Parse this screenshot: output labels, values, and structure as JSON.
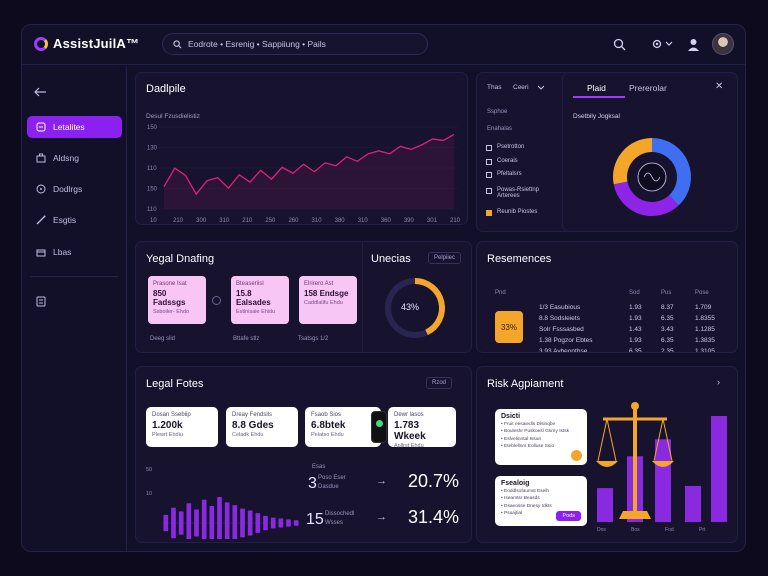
{
  "app": {
    "name": "AssistJuilA™"
  },
  "search": {
    "placeholder": "Eodrote • Esrenig • Sappiiung • Pails"
  },
  "sidebar": {
    "items": [
      {
        "label": "Letalites",
        "icon": "scale-icon"
      },
      {
        "label": "Aldsng",
        "icon": "briefcase-icon"
      },
      {
        "label": "Dodlrgs",
        "icon": "chat-icon"
      },
      {
        "label": "Esgtis",
        "icon": "pen-icon"
      },
      {
        "label": "Lbas",
        "icon": "building-icon"
      }
    ]
  },
  "timeline": {
    "title": "Dadlpile",
    "subtitle": "Desul Fzusdielistiz",
    "chart_data": {
      "type": "line",
      "y_ticks": [
        "150",
        "130",
        "110",
        "150",
        "110"
      ],
      "x_ticks": [
        "10",
        "210",
        "300",
        "310",
        "210",
        "250",
        "260",
        "310",
        "380",
        "310",
        "360",
        "390",
        "301",
        "210"
      ],
      "series": [
        {
          "values": [
            30,
            55,
            45,
            20,
            38,
            42,
            28,
            46,
            36,
            52,
            40,
            56,
            48,
            60,
            50,
            62,
            58,
            70,
            64,
            74,
            78,
            74,
            84,
            80,
            86,
            94,
            92,
            100
          ]
        }
      ],
      "y_range": [
        0,
        110
      ],
      "color": "#e0207a"
    }
  },
  "filters": {
    "tab1": "Thas",
    "tab2": "Ceeri",
    "heading1": "Ssphoe",
    "heading2": "Enahalas",
    "items": [
      "Psetrotton",
      "Coerais",
      "Pfeltalsrs",
      "Powas-Rsiettnp Arterees",
      "Reunib Piostes"
    ]
  },
  "distribution": {
    "tab_active": "Plaid",
    "tab_other": "Prererolar",
    "title": "Dsetbily Jogksal",
    "chart_data": {
      "type": "pie",
      "slices": [
        {
          "value": 38,
          "color": "#3f6ff0"
        },
        {
          "value": 34,
          "color": "#8e24e8"
        },
        {
          "value": 28,
          "color": "#f4a62a"
        }
      ]
    }
  },
  "legal_drafting": {
    "title": "Yegal Dnafing",
    "cards": [
      {
        "l1": "Prasone Isat",
        "l2": "850 Fadssgs",
        "l3": "Ssboiler- Ehdo"
      },
      {
        "l1": "Bteaseriisl",
        "l2": "15.8 Ealsades",
        "l3": "Estlnisale Ehidu"
      },
      {
        "l1": "Elrirero Ast",
        "l2": "158 Endsge",
        "l3": "Caddlalifu Ehdu"
      }
    ],
    "footer": [
      "Deeg slid",
      "Bttafe stlz",
      "Tsatsgs 1/2"
    ]
  },
  "utilities": {
    "title": "Unecias",
    "pill": "Pelpiiec",
    "percent": "43%",
    "chart_data": {
      "type": "pie",
      "slices": [
        {
          "value": 43,
          "color": "#f4a62a"
        },
        {
          "value": 57,
          "color": "#2a2550"
        }
      ]
    }
  },
  "resemences": {
    "title": "Resemences",
    "badge": "33%",
    "header": [
      "Pnd",
      "Sod",
      "Pus",
      "Pose"
    ],
    "rows": [
      [
        "1/3 Easubious",
        "1.93",
        "8.37",
        "1.709"
      ],
      [
        "8.8 Sodsleiets",
        "1.93",
        "6.35",
        "1.8355"
      ],
      [
        "Solr Fsssasbed",
        "1.43",
        "3.43",
        "1.1285"
      ],
      [
        "1.38 Pogzor Ebtes",
        "1.93",
        "6.35",
        "1.3835"
      ],
      [
        "3.93 Avbeonthse",
        "6.35",
        "2.35",
        "1.3105"
      ]
    ]
  },
  "legal_notes": {
    "title": "Legal Fotes",
    "pill": "Rzod",
    "cards": [
      {
        "l1": "Dosan Ssebiip",
        "l2": "1.200k",
        "l3": "Plewrt Ehdiu"
      },
      {
        "l1": "Dreay Fendsils",
        "l2": "8.8 Gdes",
        "l3": "Celadk Ehdu"
      },
      {
        "l1": "Fsaob Sios",
        "l2": "6.8btek",
        "l3": "Pelatso Ehdu"
      },
      {
        "l1": "Dewr lasos",
        "l2": "1.783 Wkeek",
        "l3": "Apllrst Ehdu"
      }
    ],
    "chart_data": {
      "type": "bar",
      "values": [
        18,
        34,
        26,
        44,
        30,
        52,
        38,
        58,
        46,
        40,
        32,
        28,
        22,
        16,
        12,
        10,
        8,
        6
      ],
      "color": "#8a2ae0"
    },
    "stats": [
      {
        "prefix": "3",
        "label1": "Poso Eser",
        "label2": "Dasdue",
        "value": "20.7%"
      },
      {
        "prefix": "15",
        "label1": "Dissochedl",
        "label2": "Wsses",
        "value": "31.4%"
      }
    ],
    "stats_heading": "Esas"
  },
  "risk": {
    "title": "Risk Agpiament",
    "box1": {
      "title": "Dsicti",
      "items": [
        "Fruit eesaiedis Dlsinqbe",
        "Bouleshr Puskoesl Gsrey Istsk",
        "Eslvelinntal Issuit",
        "Eteblellnrs Eolluse Ssio"
      ]
    },
    "box2": {
      "title": "Fsealoig",
      "items": [
        "Eoddlsofaumst Eselh",
        "Iseamtsr Beasds",
        "Dsaeosse Dnesy Idkts",
        "Psuajtial"
      ],
      "button": "Pods"
    },
    "chart_data": {
      "type": "bar",
      "categories": [
        "Dos",
        "Bos",
        "Fod",
        "Prt"
      ],
      "values": [
        32,
        62,
        78,
        34,
        100
      ],
      "color": "#8a2ae0"
    }
  }
}
